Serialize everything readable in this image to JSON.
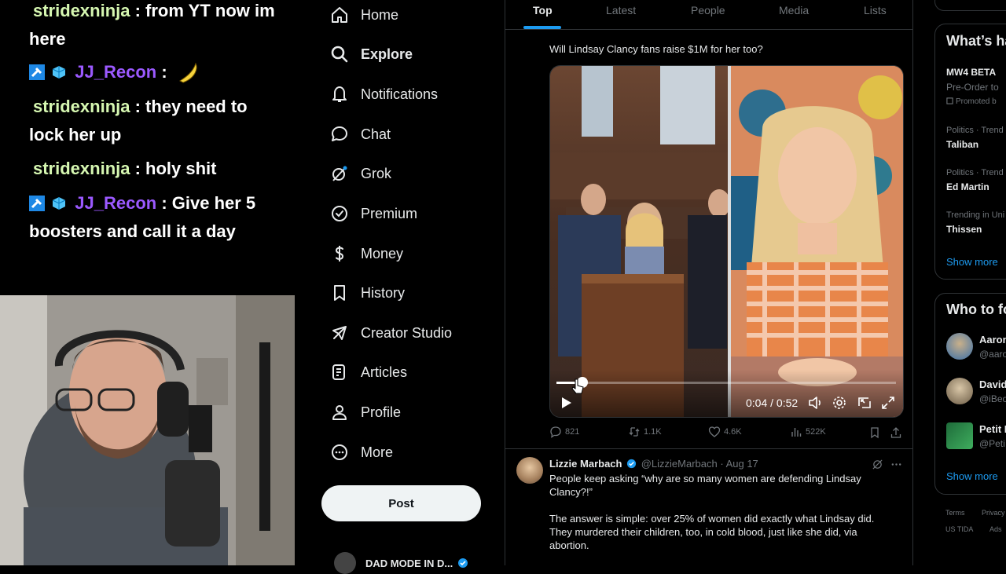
{
  "chat": {
    "messages": [
      {
        "user": "stridexninja",
        "text": ": from YT now im here",
        "color": "#d6f7b1",
        "badges": false
      },
      {
        "user": "JJ_Recon",
        "text": ":",
        "color": "#9b59ff",
        "badges": true,
        "emote": "banana-emote"
      },
      {
        "user": "stridexninja",
        "text": ": they need to lock her up",
        "color": "#d6f7b1",
        "badges": false
      },
      {
        "user": "stridexninja",
        "text": ": holy shit",
        "color": "#d6f7b1",
        "badges": false
      },
      {
        "user": "JJ_Recon",
        "text": ": Give her 5 boosters and call it a day",
        "color": "#9b59ff",
        "badges": true
      }
    ]
  },
  "nav": {
    "items": [
      {
        "label": "Home",
        "icon": "home-icon"
      },
      {
        "label": "Explore",
        "icon": "search-icon",
        "bold": true
      },
      {
        "label": "Notifications",
        "icon": "bell-icon"
      },
      {
        "label": "Chat",
        "icon": "chat-bubble-icon"
      },
      {
        "label": "Grok",
        "icon": "grok-icon"
      },
      {
        "label": "Premium",
        "icon": "verified-icon"
      },
      {
        "label": "Money",
        "icon": "dollar-icon"
      },
      {
        "label": "History",
        "icon": "bookmark-icon"
      },
      {
        "label": "Creator Studio",
        "icon": "rocket-icon"
      },
      {
        "label": "Articles",
        "icon": "article-icon"
      },
      {
        "label": "Profile",
        "icon": "person-icon"
      },
      {
        "label": "More",
        "icon": "more-circle-icon"
      }
    ],
    "post_label": "Post",
    "account_name": "DAD MODE IN D..."
  },
  "timeline": {
    "tabs": [
      "Top",
      "Latest",
      "People",
      "Media",
      "Lists"
    ],
    "active_tab": "Top",
    "tweet1": {
      "text": "Will Lindsay Clancy fans raise $1M for her too?",
      "video": {
        "time": "0:04 / 0:52",
        "progress": 0.077
      },
      "replies": "821",
      "reposts": "1.1K",
      "likes": "4.6K",
      "views": "522K"
    },
    "tweet2": {
      "name": "Lizzie Marbach",
      "handle": "@LizzieMarbach",
      "date": "· Aug 17",
      "para1": "People keep asking “why are so many women are defending Lindsay Clancy?!”",
      "para2": "The answer is simple: over 25% of women did exactly what Lindsay did. They murdered their children, too, in cold blood, just like she did, via abortion."
    }
  },
  "sidebar": {
    "whats_happening_title": "What’s ha",
    "trends": [
      {
        "category": "MW4 BETA",
        "sub": "Pre-Order to",
        "promo": "Promoted b"
      },
      {
        "category": "Politics · Trend",
        "name": "Taliban"
      },
      {
        "category": "Politics · Trend",
        "name": "Ed Martin"
      },
      {
        "category": "Trending in Uni",
        "name": "Thissen"
      }
    ],
    "show_more": "Show more",
    "who_to_follow_title": "Who to fo",
    "follows": [
      {
        "name": "Aaron",
        "handle": "@aaro"
      },
      {
        "name": "David",
        "handle": "@iBeo"
      },
      {
        "name": "Petit F",
        "handle": "@Peti"
      }
    ],
    "footer": [
      "Terms",
      "Privacy",
      "US TIDA",
      "Ads"
    ]
  },
  "colors": {
    "accent": "#1d9bf0",
    "background": "#000000"
  }
}
